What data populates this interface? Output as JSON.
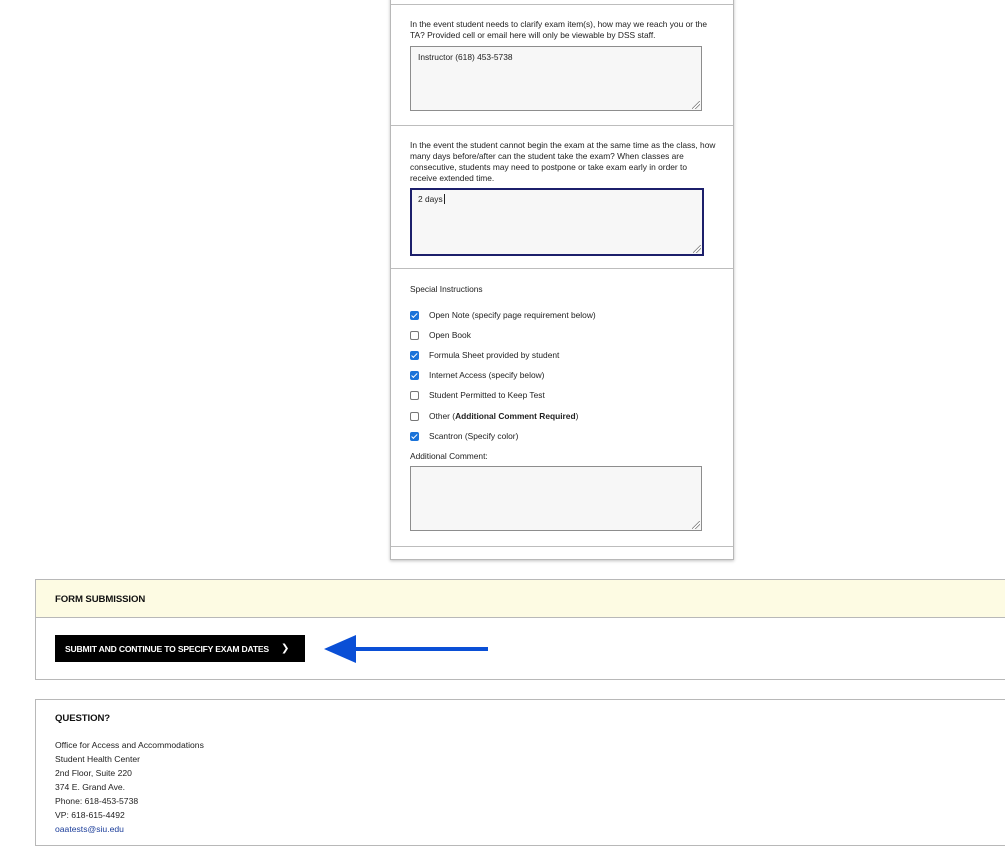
{
  "exam_form": {
    "contact_question": "In the event student needs to clarify exam item(s), how may we reach you or the TA? Provided cell or email here will only be viewable by DSS staff.",
    "contact_value": "Instructor (618) 453-5738",
    "timing_question": "In the event the student cannot begin the exam at the same time as the class, how many days before/after can the student take the exam? When classes are consecutive, students may need to postpone or take exam early in order to receive extended time.",
    "timing_value": "2 days",
    "special_instructions_heading": "Special Instructions",
    "options": [
      {
        "label": "Open Note (specify page requirement below)",
        "checked": true
      },
      {
        "label": "Open Book",
        "checked": false
      },
      {
        "label": "Formula Sheet provided by student",
        "checked": true
      },
      {
        "label": "Internet Access (specify below)",
        "checked": true
      },
      {
        "label": "Student Permitted to Keep Test",
        "checked": false
      },
      {
        "label_prefix": "Other (",
        "label_bold": "Additional Comment Required",
        "label_suffix": ")",
        "checked": false
      },
      {
        "label": "Scantron (Specify color)",
        "checked": true
      }
    ],
    "additional_comment_label": "Additional Comment:",
    "additional_comment_value": ""
  },
  "submission": {
    "title": "FORM SUBMISSION",
    "button_label": "SUBMIT AND CONTINUE TO SPECIFY EXAM DATES",
    "button_icon": "chevron-right-icon",
    "pointer_annotation": "arrow-left-icon"
  },
  "question_panel": {
    "title": "QUESTION?",
    "lines": [
      "Office for Access and Accommodations",
      "Student Health Center",
      "2nd Floor, Suite 220",
      "374 E. Grand Ave.",
      "Phone: 618-453-5738",
      "VP: 618-615-4492"
    ],
    "email": "oaatests@siu.edu"
  },
  "colors": {
    "checkbox_checked": "#1a73d9",
    "panel_header_bg": "#fdfbe3",
    "arrow": "#0a4fd6",
    "link": "#1b3d9a",
    "focus_border": "#1c1f6b"
  }
}
